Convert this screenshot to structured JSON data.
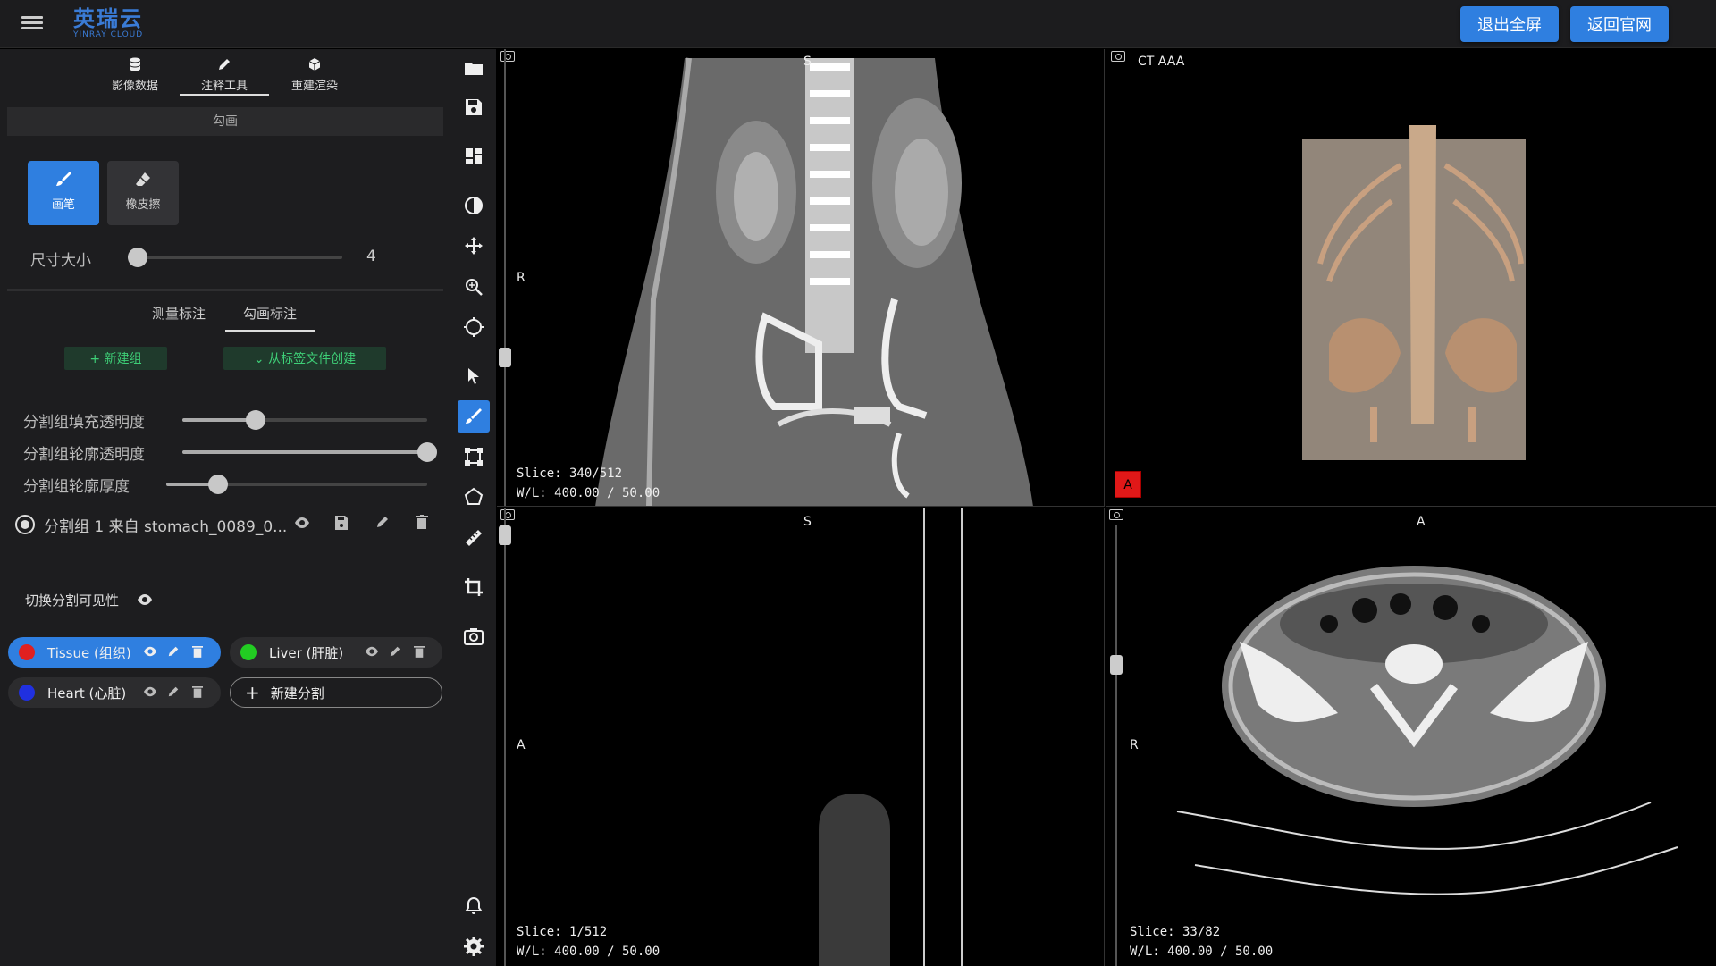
{
  "header": {
    "logo_cn": "英瑞云",
    "logo_en": "YINRAY CLOUD",
    "exit_fullscreen": "退出全屏",
    "back_official": "返回官网"
  },
  "sidebar": {
    "tabs": [
      {
        "label": "影像数据",
        "icon": "database-icon"
      },
      {
        "label": "注释工具",
        "icon": "pencil-icon"
      },
      {
        "label": "重建渲染",
        "icon": "cube-icon"
      }
    ],
    "section_title": "勾画",
    "tools": [
      {
        "label": "画笔",
        "icon": "brush-icon",
        "active": true
      },
      {
        "label": "橡皮擦",
        "icon": "eraser-icon",
        "active": false
      }
    ],
    "size_label": "尺寸大小",
    "size_value": "4",
    "size_level": 0.05,
    "subtabs": [
      "测量标注",
      "勾画标注"
    ],
    "new_group": "+ 新建组",
    "from_label_file": "⌄ 从标签文件创建",
    "fill_opacity_label": "分割组填充透明度",
    "fill_opacity": 0.3,
    "outline_opacity_label": "分割组轮廓透明度",
    "outline_opacity": 1.0,
    "outline_thickness_label": "分割组轮廓厚度",
    "outline_thickness": 0.2,
    "group_name": "分割组 1 来自 stomach_0089_0...",
    "toggle_visibility": "切换分割可见性",
    "segments": [
      {
        "label": "Tissue (组织)",
        "color": "#e02020",
        "active": true
      },
      {
        "label": "Liver (肝脏)",
        "color": "#22cc22",
        "active": false
      },
      {
        "label": "Heart (心脏)",
        "color": "#2030e0",
        "active": false
      }
    ],
    "new_segment": "新建分割"
  },
  "viewports": {
    "coronal": {
      "top": "S",
      "left": "R",
      "slice": "Slice: 340/512",
      "wl": "W/L: 400.00 / 50.00"
    },
    "volume": {
      "title": "CT AAA",
      "marker": "A"
    },
    "sagittal": {
      "top": "S",
      "left": "A",
      "slice": "Slice: 1/512",
      "wl": "W/L: 400.00 / 50.00"
    },
    "axial": {
      "top": "A",
      "left": "R",
      "slice": "Slice: 33/82",
      "wl": "W/L: 400.00 / 50.00"
    }
  },
  "colors": {
    "accent": "#2f7fe0",
    "green": "#3ecf77"
  }
}
